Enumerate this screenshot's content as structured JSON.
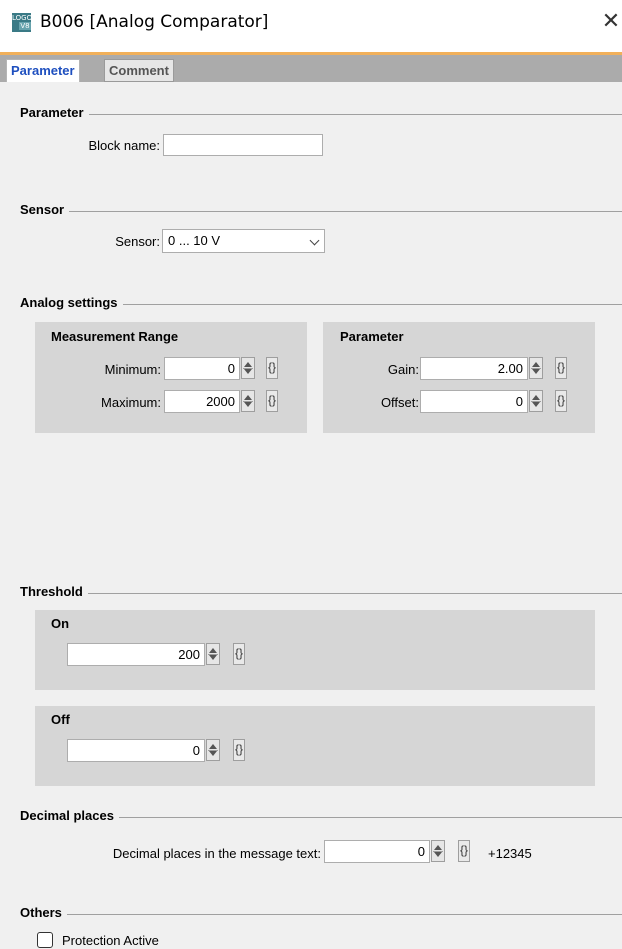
{
  "window": {
    "title": "B006 [Analog Comparator]",
    "icon_text_top": "LOGO",
    "icon_text_bottom": "V8",
    "close_glyph": "✕"
  },
  "tabs": [
    {
      "label": "Parameter",
      "active": true
    },
    {
      "label": "Comment",
      "active": false
    }
  ],
  "sections": {
    "parameter": {
      "title": "Parameter",
      "block_name_label": "Block name:",
      "block_name_value": ""
    },
    "sensor": {
      "title": "Sensor",
      "sensor_label": "Sensor:",
      "sensor_value": "0 ... 10 V"
    },
    "analog": {
      "title": "Analog settings",
      "measurement_range": {
        "title": "Measurement Range",
        "minimum_label": "Minimum:",
        "minimum_value": "0",
        "maximum_label": "Maximum:",
        "maximum_value": "2000"
      },
      "parameter": {
        "title": "Parameter",
        "gain_label": "Gain:",
        "gain_value": "2.00",
        "offset_label": "Offset:",
        "offset_value": "0"
      }
    },
    "threshold": {
      "title": "Threshold",
      "on_title": "On",
      "on_value": "200",
      "off_title": "Off",
      "off_value": "0"
    },
    "decimal": {
      "title": "Decimal places",
      "label": "Decimal places in the message text:",
      "value": "0",
      "preview": "+12345"
    },
    "others": {
      "title": "Others",
      "protection_label": "Protection Active",
      "protection_checked": false
    }
  },
  "param_button_glyph": "{}",
  "colors": {
    "tab_accent": "#f1b05a",
    "active_tab_text": "#1e4fbf",
    "group_bg": "#d6d6d6"
  }
}
